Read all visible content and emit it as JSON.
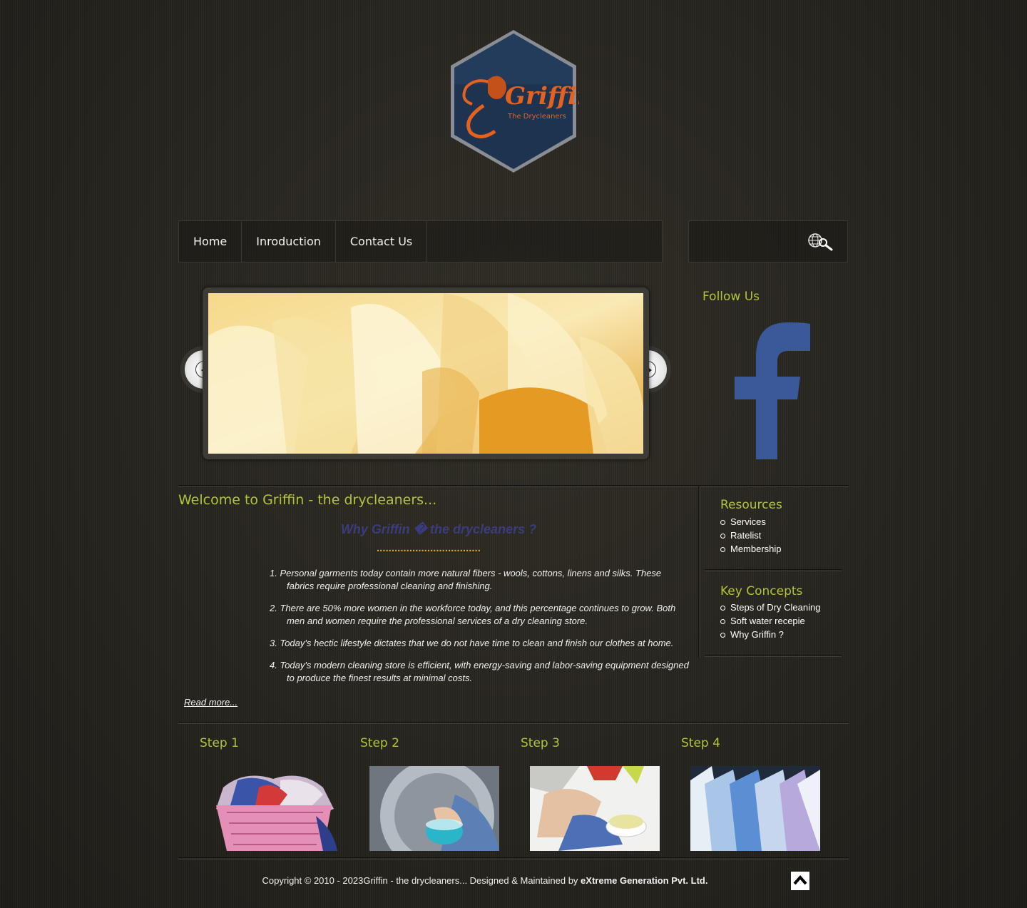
{
  "brand": {
    "logo_name": "Griffin",
    "logo_tagline": "The Drycleaners"
  },
  "nav": {
    "items": [
      {
        "label": "Home"
      },
      {
        "label": "Inroduction"
      },
      {
        "label": "Contact Us"
      }
    ]
  },
  "search": {
    "value": "",
    "icon": "globe-search-icon"
  },
  "slider": {
    "prev_icon": "chevron-left-icon",
    "next_icon": "chevron-right-icon"
  },
  "follow": {
    "heading": "Follow Us",
    "icon": "facebook-icon",
    "brand_color": "#3b5998"
  },
  "welcome": {
    "title": "Welcome to Griffin - the drycleaners...",
    "why_heading": "Why Griffin � the drycleaners ?",
    "dot_line": "...................................",
    "items": [
      "1. Personal garments today contain more natural fibers - wools, cottons, linens and silks. These fabrics require professional cleaning and finishing.",
      "2. There are 50% more women in the workforce today, and this percentage continues to grow. Both men and women require the professional services of a dry cleaning store.",
      "3. Today's hectic lifestyle dictates that we do not have time to clean and finish our clothes at home.",
      "4. Today's modern cleaning store is efficient, with energy-saving and labor-saving equipment designed to produce the finest results at minimal costs."
    ],
    "read_more": "Read more..."
  },
  "sidebar": {
    "resources": {
      "heading": "Resources",
      "items": [
        "Services",
        "Ratelist",
        "Membership"
      ]
    },
    "key_concepts": {
      "heading": "Key Concepts",
      "items": [
        "Steps of Dry Cleaning",
        "Soft water recepie",
        "Why Griffin ?"
      ]
    }
  },
  "steps": [
    {
      "label": "Step 1"
    },
    {
      "label": "Step 2"
    },
    {
      "label": "Step 3"
    },
    {
      "label": "Step 4"
    }
  ],
  "footer": {
    "copyright": "Copyright © 2010 - 2023Griffin - the drycleaners...  Designed & Maintained by ",
    "company": "eXtreme Generation Pvt. Ltd.",
    "top_icon": "chevron-up-icon"
  },
  "colors": {
    "accent_green": "#b5c23a",
    "heading_blue": "#3b3c7e",
    "dot_gold": "#d9a920",
    "logo_orange": "#e4621e",
    "logo_navy": "#1e3350"
  }
}
